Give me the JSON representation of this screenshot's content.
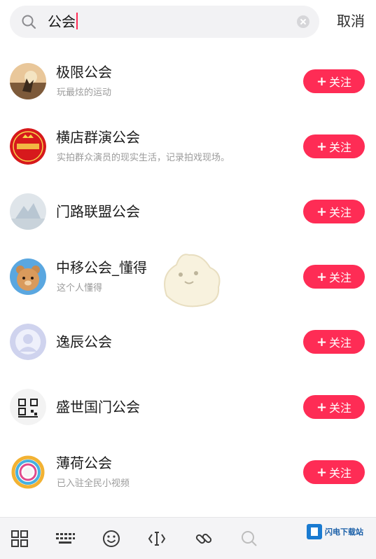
{
  "search": {
    "query": "公会",
    "cancel_label": "取消"
  },
  "results": [
    {
      "name": "极限公会",
      "description": "玩最炫的运动",
      "follow_label": "关注",
      "avatar": "sunset-silhouette"
    },
    {
      "name": "横店群演公会",
      "description": "实拍群众演员的现实生活，记录拍戏现场。",
      "follow_label": "关注",
      "avatar": "red-seal-logo"
    },
    {
      "name": "门路联盟公会",
      "description": "",
      "follow_label": "关注",
      "avatar": "grey-bird"
    },
    {
      "name": "中移公会_懂得",
      "description": "这个人懂得",
      "follow_label": "关注",
      "avatar": "cartoon-bear"
    },
    {
      "name": "逸辰公会",
      "description": "",
      "follow_label": "关注",
      "avatar": "default-user"
    },
    {
      "name": "盛世国门公会",
      "description": "",
      "follow_label": "关注",
      "avatar": "qr-code-logo"
    },
    {
      "name": "薄荷公会",
      "description": "已入驻全民小视频",
      "follow_label": "关注",
      "avatar": "colorful-ring"
    }
  ],
  "toolbar": {
    "icons": [
      "grid-icon",
      "keyboard-icon",
      "emoji-icon",
      "cursor-icon",
      "link-icon",
      "search-icon"
    ]
  },
  "watermark": {
    "text": "闪电下载站"
  },
  "colors": {
    "accent": "#fe2c55",
    "toolbar_bg": "#f4f4f6"
  }
}
